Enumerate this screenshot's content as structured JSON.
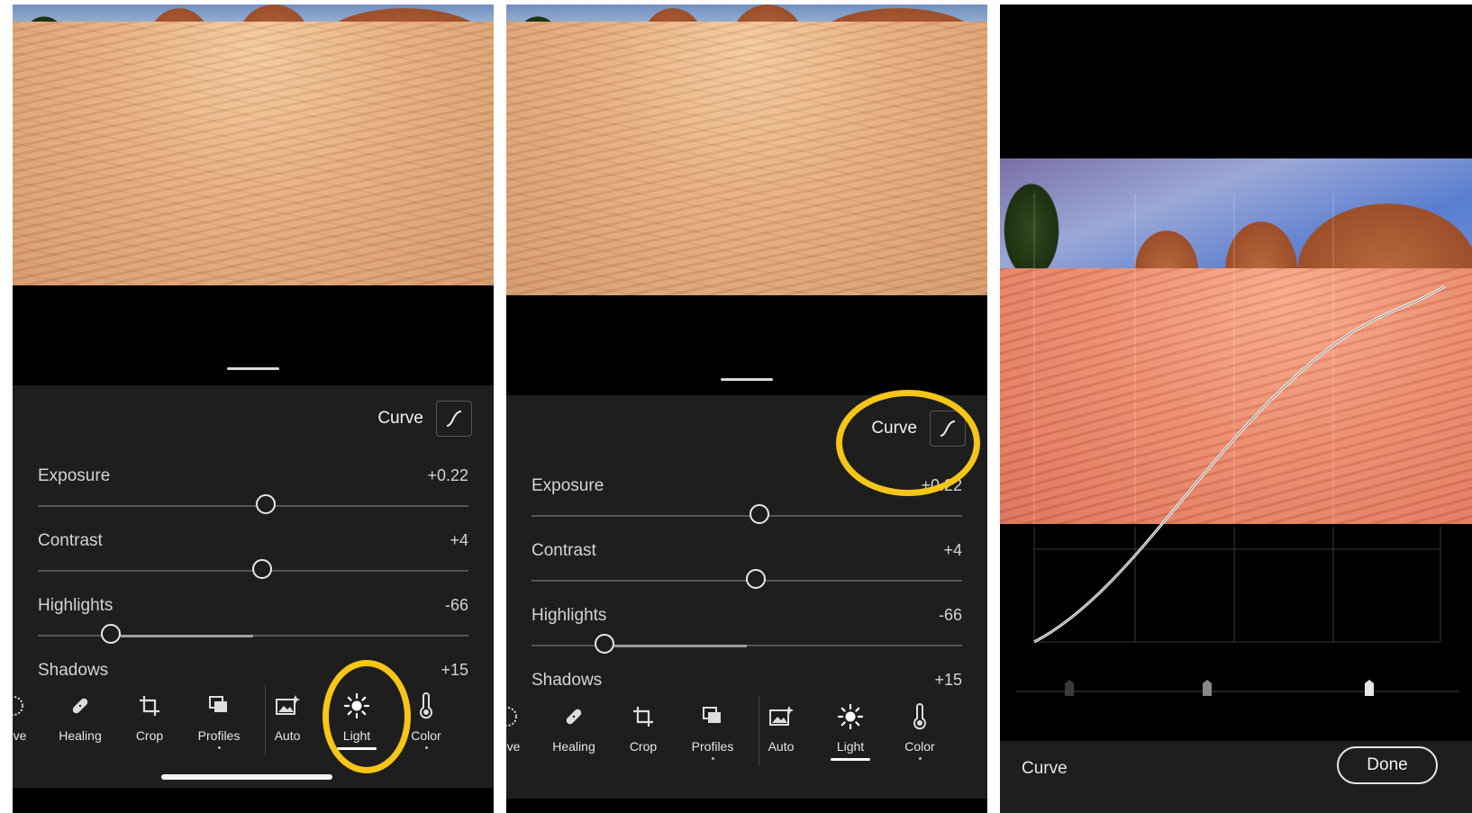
{
  "screens": [
    {
      "id": "screen-1",
      "curve": {
        "label": "Curve"
      },
      "sliders": [
        {
          "name": "Exposure",
          "value": "+0.22",
          "fraction": 0.53
        },
        {
          "name": "Contrast",
          "value": "+4",
          "fraction": 0.52
        },
        {
          "name": "Highlights",
          "value": "-66",
          "fraction": 0.17
        },
        {
          "name": "Shadows",
          "value": "+15"
        }
      ],
      "tools": [
        {
          "label": "ctive",
          "icon": "selective-icon"
        },
        {
          "label": "Healing",
          "icon": "bandage-icon"
        },
        {
          "label": "Crop",
          "icon": "crop-icon"
        },
        {
          "label": "Profiles",
          "icon": "profiles-icon"
        },
        {
          "label": "Auto",
          "icon": "auto-icon"
        },
        {
          "label": "Light",
          "icon": "sun-icon",
          "active": true
        },
        {
          "label": "Color",
          "icon": "thermometer-icon"
        }
      ],
      "highlight": "Light"
    },
    {
      "id": "screen-2",
      "curve": {
        "label": "Curve"
      },
      "sliders": [
        {
          "name": "Exposure",
          "value": "+0.22",
          "fraction": 0.53
        },
        {
          "name": "Contrast",
          "value": "+4",
          "fraction": 0.52
        },
        {
          "name": "Highlights",
          "value": "-66",
          "fraction": 0.17
        },
        {
          "name": "Shadows",
          "value": "+15"
        }
      ],
      "tools": [
        {
          "label": "ctive",
          "icon": "selective-icon"
        },
        {
          "label": "Healing",
          "icon": "bandage-icon"
        },
        {
          "label": "Crop",
          "icon": "crop-icon"
        },
        {
          "label": "Profiles",
          "icon": "profiles-icon"
        },
        {
          "label": "Auto",
          "icon": "auto-icon"
        },
        {
          "label": "Light",
          "icon": "sun-icon",
          "active": true
        },
        {
          "label": "Color",
          "icon": "thermometer-icon"
        }
      ],
      "highlight": "Curve"
    },
    {
      "id": "screen-3",
      "bottom_label": "Curve",
      "done_label": "Done"
    }
  ],
  "colors": {
    "highlight_ring": "#f5c518",
    "panel_bg": "#1e1e1e"
  }
}
